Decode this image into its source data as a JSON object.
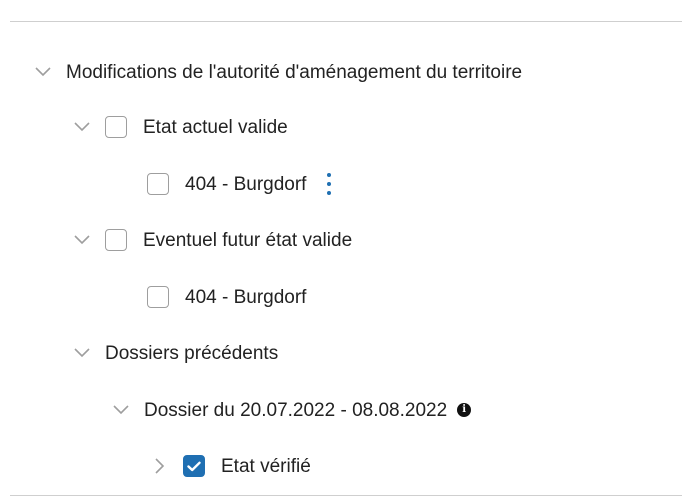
{
  "tree": {
    "root": {
      "label": "Modifications de l'autorité d'aménagement du territoire",
      "expanded": true
    },
    "current_state": {
      "label": "Etat actuel valide",
      "expanded": true,
      "checked": false,
      "child": {
        "label": "404 - Burgdorf",
        "checked": false,
        "menu_icon": "more-vertical-icon"
      }
    },
    "future_state": {
      "label": "Eventuel futur état valide",
      "expanded": true,
      "checked": false,
      "child": {
        "label": "404 - Burgdorf",
        "checked": false
      }
    },
    "previous_dossiers": {
      "label": "Dossiers précédents",
      "expanded": true,
      "dossier": {
        "label": "Dossier du 20.07.2022 - 08.08.2022",
        "expanded": true,
        "info_icon": "info-icon",
        "info_glyph": "i",
        "child": {
          "label": "Etat vérifié",
          "expanded": false,
          "checked": true
        }
      }
    }
  },
  "colors": {
    "accent": "#1f6fb2",
    "text": "#222222",
    "chevron": "#9e9e9e",
    "divider": "#cfcfcf"
  }
}
